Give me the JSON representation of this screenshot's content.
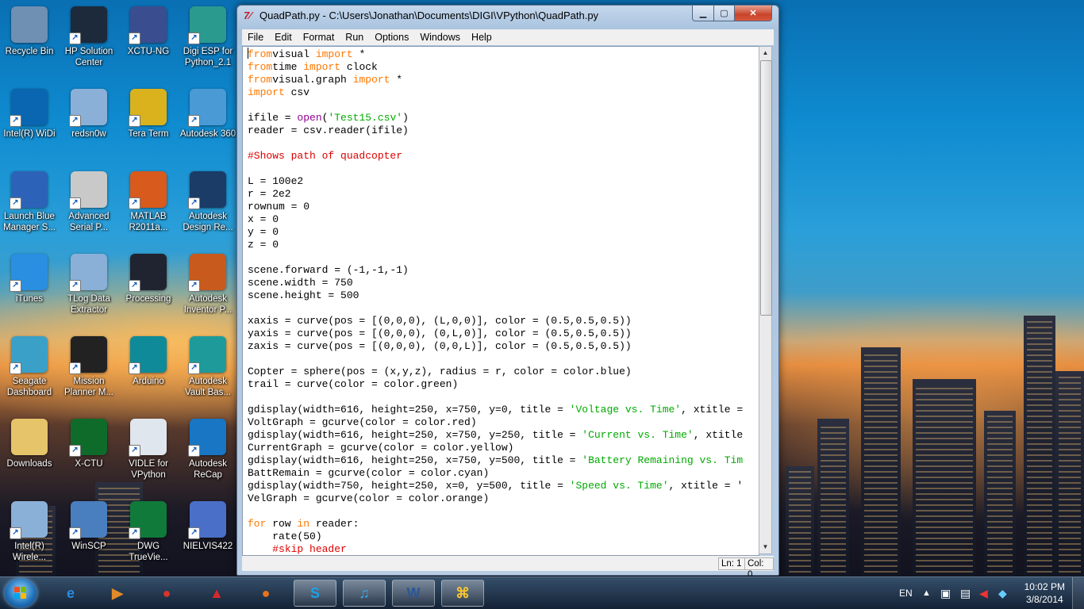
{
  "desktop": {
    "icons": [
      {
        "label": "Recycle Bin",
        "icon": "recycle-bin-icon",
        "color": "#6f8fb3"
      },
      {
        "label": "HP Solution Center",
        "icon": "hp-icon",
        "color": "#1c2a3c"
      },
      {
        "label": "XCTU-NG",
        "icon": "xctu-icon",
        "color": "#3a4d8f"
      },
      {
        "label": "Digi ESP for Python_2.1",
        "icon": "digi-esp-icon",
        "color": "#2a9a8f"
      },
      {
        "label": "Intel(R) WiDi",
        "icon": "widi-icon",
        "color": "#0a66b0"
      },
      {
        "label": "redsn0w",
        "icon": "window-app-icon",
        "color": "#8ab0d8"
      },
      {
        "label": "Tera Term",
        "icon": "tera-term-icon",
        "color": "#d9b21e"
      },
      {
        "label": "Autodesk 360",
        "icon": "autodesk-360-icon",
        "color": "#4a9ad6"
      },
      {
        "label": "Launch Blue Manager S...",
        "icon": "bluetooth-tower-icon",
        "color": "#2c63b8"
      },
      {
        "label": "Advanced Serial P...",
        "icon": "serial-port-icon",
        "color": "#c9c9c9"
      },
      {
        "label": "MATLAB R2011a...",
        "icon": "matlab-icon",
        "color": "#d95a1d"
      },
      {
        "label": "Autodesk Design Re...",
        "icon": "autodesk-design-review-icon",
        "color": "#1b3c66"
      },
      {
        "label": "iTunes",
        "icon": "itunes-icon",
        "color": "#2a8fe0"
      },
      {
        "label": "TLog Data Extractor",
        "icon": "window-app-icon",
        "color": "#8ab0d8"
      },
      {
        "label": "Processing",
        "icon": "processing-icon",
        "color": "#1f2430"
      },
      {
        "label": "Autodesk Inventor P...",
        "icon": "inventor-icon",
        "color": "#c85a1e"
      },
      {
        "label": "Seagate Dashboard",
        "icon": "seagate-icon",
        "color": "#3aa0c8"
      },
      {
        "label": "Mission Planner M...",
        "icon": "mission-planner-icon",
        "color": "#222222"
      },
      {
        "label": "Arduino",
        "icon": "arduino-icon",
        "color": "#0f8a98"
      },
      {
        "label": "Autodesk Vault Bas...",
        "icon": "vault-icon",
        "color": "#1f9a9a"
      },
      {
        "label": "Downloads",
        "icon": "folder-icon",
        "color": "#e6c46a"
      },
      {
        "label": "X-CTU",
        "icon": "xctu-board-icon",
        "color": "#0f6b2a"
      },
      {
        "label": "VIDLE for VPython",
        "icon": "python-icon",
        "color": "#e0e6ee"
      },
      {
        "label": "Autodesk ReCap",
        "icon": "recap-icon",
        "color": "#1876c4"
      },
      {
        "label": "Intel(R) Wirele...",
        "icon": "window-app-icon",
        "color": "#8ab0d8"
      },
      {
        "label": "WinSCP",
        "icon": "winscp-icon",
        "color": "#4a7fbf"
      },
      {
        "label": "DWG TrueVie...",
        "icon": "dwg-icon",
        "color": "#0f7a3a"
      },
      {
        "label": "NIELVIS422",
        "icon": "winrar-icon",
        "color": "#4a6fc8"
      }
    ]
  },
  "window": {
    "title": "QuadPath.py - C:\\Users\\Jonathan\\Documents\\DIGI\\VPython\\QuadPath.py",
    "title_icon": "7⁄",
    "menu": [
      "File",
      "Edit",
      "Format",
      "Run",
      "Options",
      "Windows",
      "Help"
    ],
    "status": {
      "line": "Ln: 1",
      "col": "Col: 0"
    }
  },
  "code_lines": [
    [
      [
        "kw",
        "from"
      ],
      [
        "",
        "visual "
      ],
      [
        "kw",
        "import"
      ],
      [
        "",
        " *"
      ]
    ],
    [
      [
        "kw",
        "from"
      ],
      [
        "",
        "time "
      ],
      [
        "kw",
        "import"
      ],
      [
        "",
        " clock"
      ]
    ],
    [
      [
        "kw",
        "from"
      ],
      [
        "",
        "visual.graph "
      ],
      [
        "kw",
        "import"
      ],
      [
        "",
        " *"
      ]
    ],
    [
      [
        "kw",
        "import"
      ],
      [
        "",
        " csv"
      ]
    ],
    [],
    [
      [
        "",
        "ifile = "
      ],
      [
        "bi",
        "open"
      ],
      [
        "",
        "("
      ],
      [
        "st",
        "'Test15.csv'"
      ],
      [
        "",
        ")"
      ]
    ],
    [
      [
        "",
        "reader = csv.reader(ifile)"
      ]
    ],
    [],
    [
      [
        "cm",
        "#Shows path of quadcopter"
      ]
    ],
    [],
    [
      [
        "",
        "L = 100e2"
      ]
    ],
    [
      [
        "",
        "r = 2e2"
      ]
    ],
    [
      [
        "",
        "rownum = 0"
      ]
    ],
    [
      [
        "",
        "x = 0"
      ]
    ],
    [
      [
        "",
        "y = 0"
      ]
    ],
    [
      [
        "",
        "z = 0"
      ]
    ],
    [],
    [
      [
        "",
        "scene.forward = (-1,-1,-1)"
      ]
    ],
    [
      [
        "",
        "scene.width = 750"
      ]
    ],
    [
      [
        "",
        "scene.height = 500"
      ]
    ],
    [],
    [
      [
        "",
        "xaxis = curve(pos = [(0,0,0), (L,0,0)], color = (0.5,0.5,0.5))"
      ]
    ],
    [
      [
        "",
        "yaxis = curve(pos = [(0,0,0), (0,L,0)], color = (0.5,0.5,0.5))"
      ]
    ],
    [
      [
        "",
        "zaxis = curve(pos = [(0,0,0), (0,0,L)], color = (0.5,0.5,0.5))"
      ]
    ],
    [],
    [
      [
        "",
        "Copter = sphere(pos = (x,y,z), radius = r, color = color.blue)"
      ]
    ],
    [
      [
        "",
        "trail = curve(color = color.green)"
      ]
    ],
    [],
    [
      [
        "",
        "gdisplay(width=616, height=250, x=750, y=0, title = "
      ],
      [
        "st",
        "'Voltage vs. Time'"
      ],
      [
        "",
        ", xtitle ="
      ]
    ],
    [
      [
        "",
        "VoltGraph = gcurve(color = color.red)"
      ]
    ],
    [
      [
        "",
        "gdisplay(width=616, height=250, x=750, y=250, title = "
      ],
      [
        "st",
        "'Current vs. Time'"
      ],
      [
        "",
        ", xtitle"
      ]
    ],
    [
      [
        "",
        "CurrentGraph = gcurve(color = color.yellow)"
      ]
    ],
    [
      [
        "",
        "gdisplay(width=616, height=250, x=750, y=500, title = "
      ],
      [
        "st",
        "'Battery Remaining vs. Tim"
      ]
    ],
    [
      [
        "",
        "BattRemain = gcurve(color = color.cyan)"
      ]
    ],
    [
      [
        "",
        "gdisplay(width=750, height=250, x=0, y=500, title = "
      ],
      [
        "st",
        "'Speed vs. Time'"
      ],
      [
        "",
        ", xtitle = '"
      ]
    ],
    [
      [
        "",
        "VelGraph = gcurve(color = color.orange)"
      ]
    ],
    [],
    [
      [
        "kw",
        "for"
      ],
      [
        "",
        " row "
      ],
      [
        "kw",
        "in"
      ],
      [
        "",
        " reader:"
      ]
    ],
    [
      [
        "",
        "    rate(50)"
      ]
    ],
    [
      [
        "",
        "    "
      ],
      [
        "cm",
        "#skip header"
      ]
    ]
  ],
  "taskbar": {
    "items": [
      {
        "icon": "internet-explorer-icon",
        "glyph": "e",
        "color": "#2a8ae0"
      },
      {
        "icon": "media-player-icon",
        "glyph": "▶",
        "color": "#e08a2a"
      },
      {
        "icon": "chrome-icon",
        "glyph": "●",
        "color": "#d8342a"
      },
      {
        "icon": "pin-icon",
        "glyph": "▲",
        "color": "#d8282a"
      },
      {
        "icon": "firefox-icon",
        "glyph": "●",
        "color": "#e8731e"
      },
      {
        "icon": "skype-icon",
        "glyph": "S",
        "color": "#1ea0e8"
      },
      {
        "icon": "itunes-icon",
        "glyph": "♫",
        "color": "#3aa8f0"
      },
      {
        "icon": "word-icon",
        "glyph": "W",
        "color": "#2b5797"
      },
      {
        "icon": "python-idle-icon",
        "glyph": "⌘",
        "color": "#f4c430"
      }
    ],
    "language": "EN",
    "time": "10:02 PM",
    "date": "3/8/2014"
  }
}
